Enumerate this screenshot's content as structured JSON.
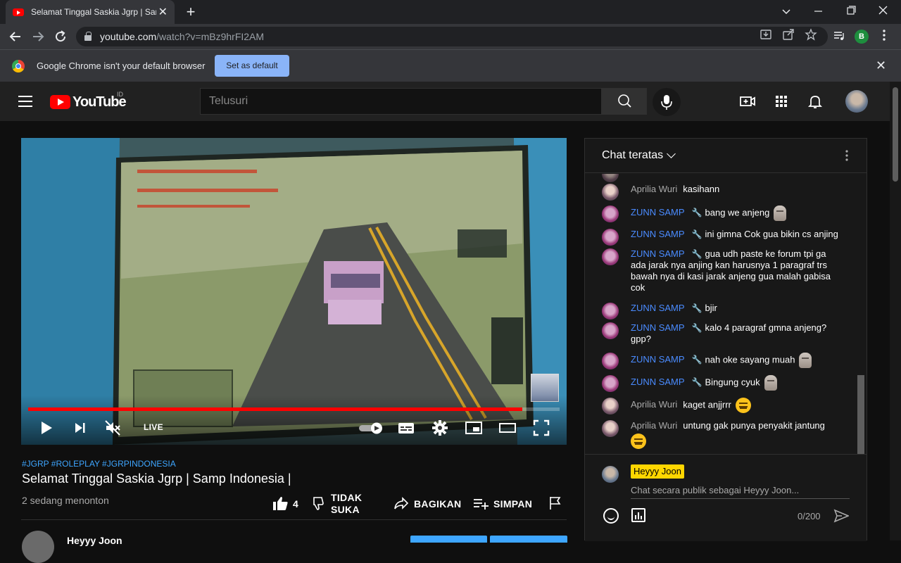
{
  "browser": {
    "tab_title": "Selamat Tinggal Saskia Jgrp | Sam",
    "tab_close": "✕",
    "new_tab": "+",
    "url_host": "youtube.com",
    "url_path": "/watch?v=mBz9hrFI2AM",
    "profile_initial": "B",
    "infobar_message": "Google Chrome isn't your default browser",
    "set_default_label": "Set as default",
    "infobar_close": "✕"
  },
  "youtube": {
    "wordmark": "YouTube",
    "country_code": "ID",
    "search_placeholder": "Telusuri"
  },
  "player": {
    "live_label": "LIVE",
    "progress_fraction": 0.93
  },
  "video": {
    "hashtags": "#JGRP #ROLEPLAY #JGRPINDONESIA",
    "title": "Selamat Tinggal Saskia Jgrp | Samp Indonesia |",
    "view_count": "2 sedang menonton",
    "like_count": "4",
    "dislike_label": "TIDAK SUKA",
    "share_label": "BAGIKAN",
    "save_label": "SIMPAN",
    "channel_name": "Heyyy Joon"
  },
  "chat": {
    "mode_label": "Chat teratas",
    "messages": [
      {
        "author": "Aprilia Wuri",
        "text": "kasihann"
      },
      {
        "author": "ZUNN SAMP",
        "text": "bang we anjeng"
      },
      {
        "author": "ZUNN SAMP",
        "text": "ini gimna Cok gua bikin cs anjing"
      },
      {
        "author": "ZUNN SAMP",
        "text": "gua udh paste ke forum tpi ga ada jarak nya anjing kan harusnya 1 paragraf trs bawah nya di kasi jarak anjeng gua malah gabisa cok"
      },
      {
        "author": "ZUNN SAMP",
        "text": "bjir"
      },
      {
        "author": "ZUNN SAMP",
        "text": "kalo 4 paragraf gmna anjeng? gpp?"
      },
      {
        "author": "ZUNN SAMP",
        "text": "nah oke sayang muah"
      },
      {
        "author": "ZUNN SAMP",
        "text": "Bingung cyuk"
      },
      {
        "author": "Aprilia Wuri",
        "text": "kaget anjjrrr"
      },
      {
        "author": "Aprilia Wuri",
        "text": "untung gak punya penyakit jantung"
      }
    ],
    "input_name": "Heyyy Joon",
    "input_placeholder": "Chat secara publik sebagai Heyyy Joon...",
    "char_counter": "0/200"
  }
}
